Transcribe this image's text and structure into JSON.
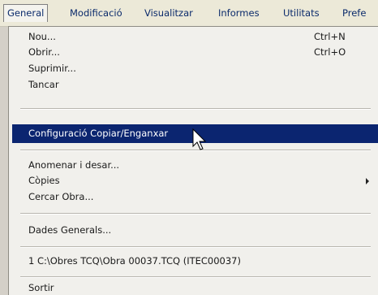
{
  "menubar": {
    "items": [
      "General",
      "Modificació",
      "Visualitzar",
      "Informes",
      "Utilitats",
      "Prefe"
    ]
  },
  "menu": {
    "new": {
      "label": "Nou...",
      "shortcut": "Ctrl+N"
    },
    "open": {
      "label": "Obrir...",
      "shortcut": "Ctrl+O"
    },
    "delete": {
      "label": "Suprimir..."
    },
    "close": {
      "label": "Tancar"
    },
    "copy_paste_config": {
      "label": "Configuració Copiar/Enganxar"
    },
    "save_as": {
      "label": "Anomenar i desar..."
    },
    "copies": {
      "label": "Còpies"
    },
    "search_work": {
      "label": "Cercar Obra..."
    },
    "general_data": {
      "label": "Dades Generals..."
    },
    "recent_file": {
      "label": "1 C:\\Obres TCQ\\Obra 00037.TCQ (ITEC00037)"
    },
    "exit": {
      "label": "Sortir"
    }
  },
  "icons": {
    "submenu_arrow": "chevron-right-icon",
    "pointer": "mouse-cursor-icon"
  },
  "colors": {
    "highlight": "#0b2570",
    "menubar_text": "#0a2a6b"
  }
}
